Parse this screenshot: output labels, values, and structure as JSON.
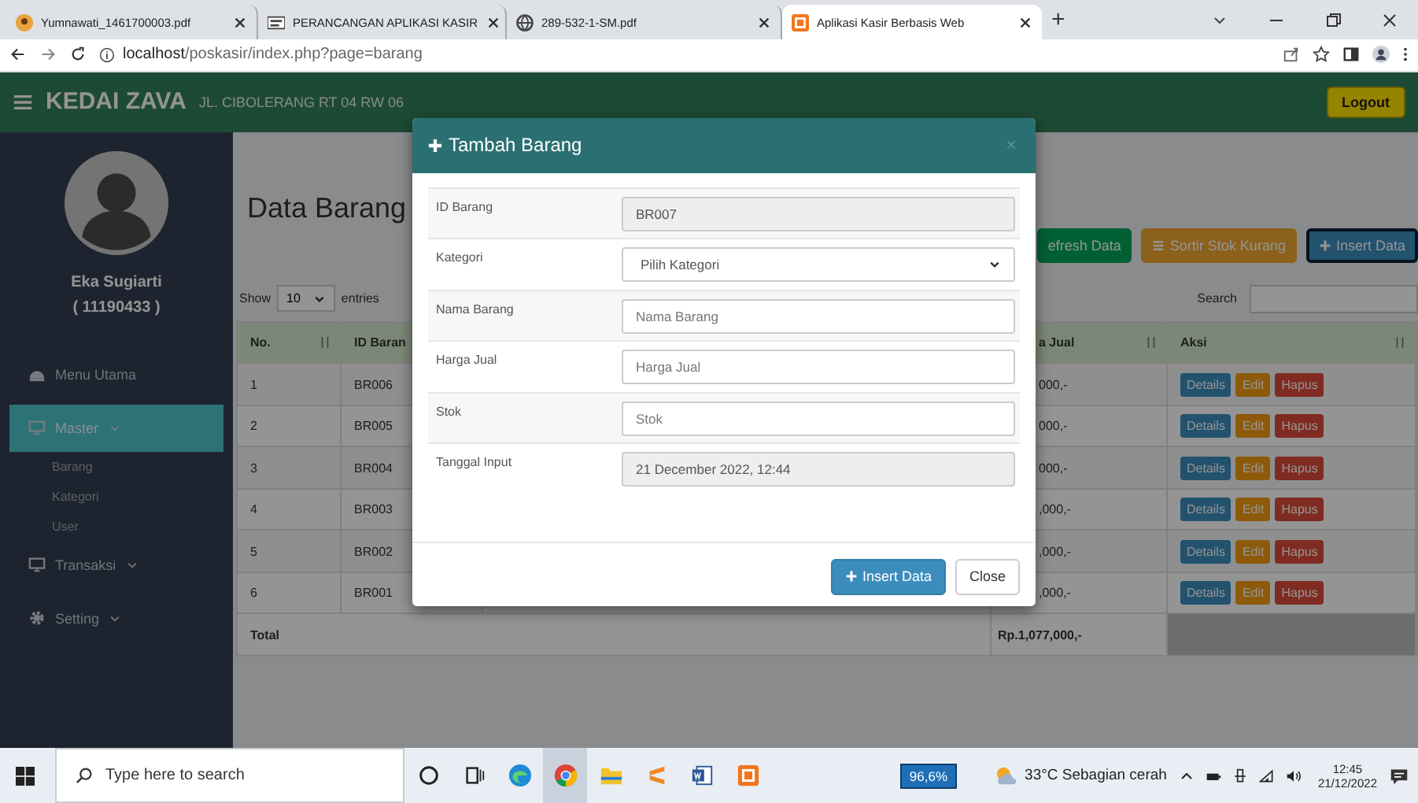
{
  "browser": {
    "tabs": [
      {
        "title": "Yumnawati_1461700003.pdf",
        "kind": "avatar",
        "selected": false
      },
      {
        "title": "PERANCANGAN APLIKASI KASIR",
        "kind": "doc",
        "selected": false
      },
      {
        "title": "289-532-1-SM.pdf",
        "kind": "globe",
        "selected": false
      },
      {
        "title": "Aplikasi Kasir Berbasis Web",
        "kind": "app",
        "selected": true
      }
    ],
    "new_tab": "+",
    "address": {
      "host": "localhost",
      "path": "/poskasir/index.php?page=barang"
    }
  },
  "header": {
    "brand": "KEDAI ZAVA",
    "address": "JL. CIBOLERANG RT 04 RW 06",
    "logout": "Logout"
  },
  "sidebar": {
    "user_name": "Eka Sugiarti",
    "user_id": "( 11190433 )",
    "menu": [
      {
        "label": "Menu Utama",
        "kind": "dashboard",
        "selected": false,
        "dropdown": false
      },
      {
        "label": "Master",
        "kind": "monitor",
        "selected": true,
        "dropdown": true,
        "children": [
          {
            "label": "Barang"
          },
          {
            "label": "Kategori"
          },
          {
            "label": "User"
          }
        ]
      },
      {
        "label": "Transaksi",
        "kind": "monitor",
        "selected": false,
        "dropdown": true
      },
      {
        "label": "Setting",
        "kind": "gear",
        "selected": false,
        "dropdown": true
      }
    ]
  },
  "content": {
    "title": "Data Barang",
    "buttons": [
      {
        "label": "efresh Data",
        "kind": "success"
      },
      {
        "label": "Sortir Stok Kurang",
        "kind": "warning"
      },
      {
        "label": "Insert Data",
        "kind": "primary"
      }
    ],
    "show": {
      "label": "Show",
      "value": "10",
      "suffix": "entries"
    },
    "search": {
      "label": "Search"
    },
    "table": {
      "columns": [
        {
          "label": "No."
        },
        {
          "label": "ID Baran"
        },
        {
          "label": "a Jual"
        },
        {
          "label": "Aksi"
        }
      ],
      "rows": [
        {
          "no": "1",
          "id": "BR006",
          "price": "000,-",
          "actions": [
            {
              "label": "Details",
              "kind": "info"
            },
            {
              "label": "Edit",
              "kind": "warning"
            },
            {
              "label": "Hapus",
              "kind": "danger"
            }
          ]
        },
        {
          "no": "2",
          "id": "BR005",
          "price": "000,-",
          "actions": [
            {
              "label": "Details",
              "kind": "info"
            },
            {
              "label": "Edit",
              "kind": "warning"
            },
            {
              "label": "Hapus",
              "kind": "danger"
            }
          ]
        },
        {
          "no": "3",
          "id": "BR004",
          "price": "000,-",
          "actions": [
            {
              "label": "Details",
              "kind": "info"
            },
            {
              "label": "Edit",
              "kind": "warning"
            },
            {
              "label": "Hapus",
              "kind": "danger"
            }
          ]
        },
        {
          "no": "4",
          "id": "BR003",
          "price": ",000,-",
          "actions": [
            {
              "label": "Details",
              "kind": "info"
            },
            {
              "label": "Edit",
              "kind": "warning"
            },
            {
              "label": "Hapus",
              "kind": "danger"
            }
          ]
        },
        {
          "no": "5",
          "id": "BR002",
          "price": ",000,-",
          "actions": [
            {
              "label": "Details",
              "kind": "info"
            },
            {
              "label": "Edit",
              "kind": "warning"
            },
            {
              "label": "Hapus",
              "kind": "danger"
            }
          ]
        },
        {
          "no": "6",
          "id": "BR001",
          "price": ",000,-",
          "actions": [
            {
              "label": "Details",
              "kind": "info"
            },
            {
              "label": "Edit",
              "kind": "warning"
            },
            {
              "label": "Hapus",
              "kind": "danger"
            }
          ]
        }
      ],
      "total": {
        "label": "Total",
        "amount": "Rp.1,077,000,-"
      }
    }
  },
  "modal": {
    "title": "Tambah Barang",
    "close": "×",
    "fields": [
      {
        "label": "ID Barang",
        "kind": "readonly",
        "value": "BR007"
      },
      {
        "label": "Kategori",
        "kind": "select",
        "value": "Pilih Kategori"
      },
      {
        "label": "Nama Barang",
        "kind": "text",
        "placeholder": "Nama Barang"
      },
      {
        "label": "Harga Jual",
        "kind": "text",
        "placeholder": "Harga Jual"
      },
      {
        "label": "Stok",
        "kind": "text",
        "placeholder": "Stok"
      },
      {
        "label": "Tanggal Input",
        "kind": "readonly",
        "value": "21 December 2022, 12:44"
      }
    ],
    "submit": "Insert Data",
    "cancel": "Close"
  },
  "taskbar": {
    "search_placeholder": "Type here to search",
    "apps": [
      {
        "kind": "cortana",
        "selected": false
      },
      {
        "kind": "taskview",
        "selected": false
      },
      {
        "kind": "edge",
        "selected": false
      },
      {
        "kind": "chrome",
        "selected": true
      },
      {
        "kind": "explorer",
        "selected": false
      },
      {
        "kind": "sublime",
        "selected": false
      },
      {
        "kind": "word",
        "selected": false
      },
      {
        "kind": "xampp",
        "selected": false
      }
    ],
    "battery": "96,6%",
    "weather": "33°C Sebagian cerah",
    "time": "12:45",
    "date": "21/12/2022"
  }
}
